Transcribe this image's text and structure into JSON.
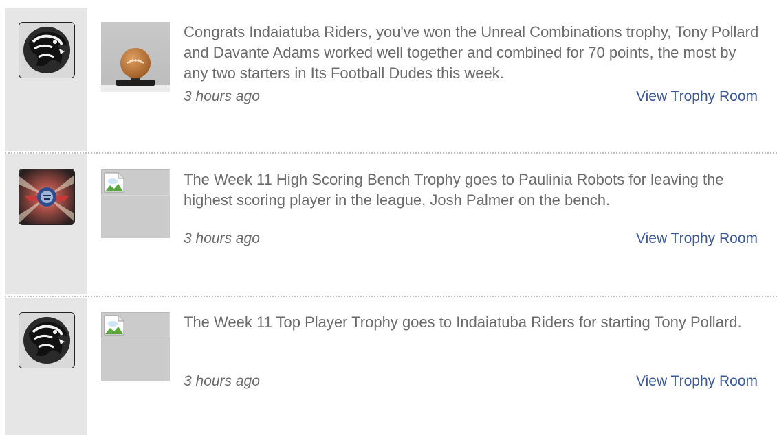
{
  "feed": {
    "items": [
      {
        "avatar_icon": "panther-logo-icon",
        "thumb_icon": "football-trophy-icon",
        "message": "Congrats Indaiatuba Riders, you've won the Unreal Combinations trophy, Tony Pollard and Davante Adams worked well together and combined for 70 points, the most by any two starters in Its Football Dudes this week.",
        "time": "3 hours ago",
        "link": "View Trophy Room"
      },
      {
        "avatar_icon": "robot-helmet-logo-icon",
        "thumb_icon": "broken-image-icon",
        "message": "The Week 11 High Scoring Bench Trophy goes to Paulinia Robots for leaving the highest scoring player in the league, Josh Palmer on the bench.",
        "time": "3 hours ago",
        "link": "View Trophy Room"
      },
      {
        "avatar_icon": "panther-logo-icon",
        "thumb_icon": "broken-image-icon",
        "message": "The Week 11 Top Player Trophy goes to Indaiatuba Riders for starting Tony Pollard.",
        "time": "3 hours ago",
        "link": "View Trophy Room"
      }
    ]
  },
  "colors": {
    "text": "#6b6b6b",
    "link": "#3b5898",
    "rail": "#e6e6e6",
    "thumb_bg": "#cbcbcb",
    "separator": "#bdbdbd"
  }
}
